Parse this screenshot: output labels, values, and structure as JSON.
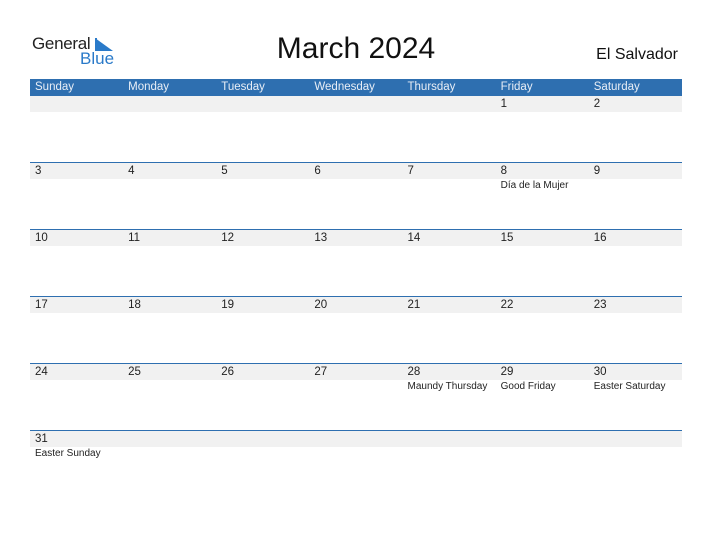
{
  "logo": {
    "word1": "General",
    "word2": "Blue"
  },
  "title": "March 2024",
  "country": "El Salvador",
  "colors": {
    "header_bg": "#2e6fb0",
    "band_bg": "#f1f1f1",
    "logo_blue": "#2a7ac9"
  },
  "weekdays": [
    "Sunday",
    "Monday",
    "Tuesday",
    "Wednesday",
    "Thursday",
    "Friday",
    "Saturday"
  ],
  "weeks": [
    [
      {
        "day": "",
        "holiday": ""
      },
      {
        "day": "",
        "holiday": ""
      },
      {
        "day": "",
        "holiday": ""
      },
      {
        "day": "",
        "holiday": ""
      },
      {
        "day": "",
        "holiday": ""
      },
      {
        "day": "1",
        "holiday": ""
      },
      {
        "day": "2",
        "holiday": ""
      }
    ],
    [
      {
        "day": "3",
        "holiday": ""
      },
      {
        "day": "4",
        "holiday": ""
      },
      {
        "day": "5",
        "holiday": ""
      },
      {
        "day": "6",
        "holiday": ""
      },
      {
        "day": "7",
        "holiday": ""
      },
      {
        "day": "8",
        "holiday": "Día de la Mujer"
      },
      {
        "day": "9",
        "holiday": ""
      }
    ],
    [
      {
        "day": "10",
        "holiday": ""
      },
      {
        "day": "11",
        "holiday": ""
      },
      {
        "day": "12",
        "holiday": ""
      },
      {
        "day": "13",
        "holiday": ""
      },
      {
        "day": "14",
        "holiday": ""
      },
      {
        "day": "15",
        "holiday": ""
      },
      {
        "day": "16",
        "holiday": ""
      }
    ],
    [
      {
        "day": "17",
        "holiday": ""
      },
      {
        "day": "18",
        "holiday": ""
      },
      {
        "day": "19",
        "holiday": ""
      },
      {
        "day": "20",
        "holiday": ""
      },
      {
        "day": "21",
        "holiday": ""
      },
      {
        "day": "22",
        "holiday": ""
      },
      {
        "day": "23",
        "holiday": ""
      }
    ],
    [
      {
        "day": "24",
        "holiday": ""
      },
      {
        "day": "25",
        "holiday": ""
      },
      {
        "day": "26",
        "holiday": ""
      },
      {
        "day": "27",
        "holiday": ""
      },
      {
        "day": "28",
        "holiday": "Maundy Thursday"
      },
      {
        "day": "29",
        "holiday": "Good Friday"
      },
      {
        "day": "30",
        "holiday": "Easter Saturday"
      }
    ],
    [
      {
        "day": "31",
        "holiday": "Easter Sunday"
      },
      {
        "day": "",
        "holiday": ""
      },
      {
        "day": "",
        "holiday": ""
      },
      {
        "day": "",
        "holiday": ""
      },
      {
        "day": "",
        "holiday": ""
      },
      {
        "day": "",
        "holiday": ""
      },
      {
        "day": "",
        "holiday": ""
      }
    ]
  ]
}
